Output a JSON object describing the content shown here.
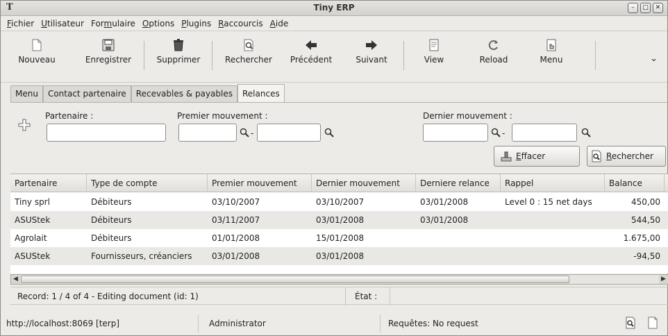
{
  "window": {
    "title": "Tiny ERP",
    "app_glyph": "T"
  },
  "menubar": [
    {
      "pre": "",
      "u": "F",
      "post": "ichier"
    },
    {
      "pre": "",
      "u": "U",
      "post": "tilisateur"
    },
    {
      "pre": "For",
      "u": "m",
      "post": "ulaire"
    },
    {
      "pre": "",
      "u": "O",
      "post": "ptions"
    },
    {
      "pre": "",
      "u": "P",
      "post": "lugins"
    },
    {
      "pre": "",
      "u": "R",
      "post": "accourcis"
    },
    {
      "pre": "",
      "u": "A",
      "post": "ide"
    }
  ],
  "toolbar": {
    "new": "Nouveau",
    "save": "Enregistrer",
    "delete": "Supprimer",
    "search": "Rechercher",
    "previous": "Précédent",
    "next": "Suivant",
    "view": "View",
    "reload": "Reload",
    "menu": "Menu",
    "more_glyph": "⌄"
  },
  "tabs": [
    "Menu",
    "Contact partenaire",
    "Recevables & payables",
    "Relances"
  ],
  "search": {
    "partenaire_label": "Partenaire :",
    "partenaire_value": "",
    "premier_label": "Premier mouvement :",
    "premier_from": "",
    "premier_to": "",
    "dernier_label": "Dernier mouvement :",
    "dernier_from": "",
    "dernier_to": "",
    "range_sep": "-",
    "clear_pre": "",
    "clear_u": "E",
    "clear_post": "ffacer",
    "search_pre": "",
    "search_u": "R",
    "search_post": "echercher"
  },
  "table": {
    "columns": [
      "Partenaire",
      "Type de compte",
      "Premier mouvement",
      "Dernier mouvement",
      "Derniere relance",
      "Rappel",
      "Balance"
    ],
    "rows": [
      [
        "Tiny sprl",
        "Débiteurs",
        "03/10/2007",
        "03/10/2007",
        "03/01/2008",
        "Level 0 : 15 net days",
        "450,00"
      ],
      [
        "ASUStek",
        "Débiteurs",
        "03/11/2007",
        "03/01/2008",
        "03/01/2008",
        "",
        "544,50"
      ],
      [
        "Agrolait",
        "Débiteurs",
        "01/01/2008",
        "15/01/2008",
        "",
        "",
        "1.675,00"
      ],
      [
        "ASUStek",
        "Fournisseurs, créanciers",
        "03/01/2008",
        "03/01/2008",
        "",
        "",
        "-94,50"
      ]
    ]
  },
  "record_bar": {
    "record": "Record: 1 / 4 of 4 - Editing document (id: 1)",
    "state_label": "État :",
    "state_value": ""
  },
  "status_bar": {
    "url": "http://localhost:8069 [terp]",
    "user": "Administrator",
    "requests": "Requêtes:  No request"
  }
}
